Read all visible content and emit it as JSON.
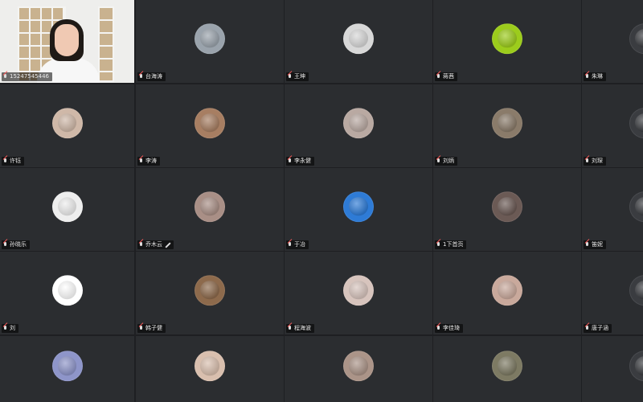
{
  "meeting": {
    "participants": [
      {
        "name": "15247545446",
        "type": "video"
      },
      {
        "name": "台海涛",
        "avatar_color": "#9aa3ac"
      },
      {
        "name": "王坤",
        "avatar_color": "#d8d8d8"
      },
      {
        "name": "蒋茜",
        "avatar_color": "#9ccc1c"
      },
      {
        "name": "朱琳",
        "avatar_color": "#3a3c40"
      },
      {
        "name": "许钰",
        "avatar_color": "#cfb8a8"
      },
      {
        "name": "李涛",
        "avatar_color": "#a77e62"
      },
      {
        "name": "李永健",
        "avatar_color": "#b9a9a2"
      },
      {
        "name": "刘炳",
        "avatar_color": "#8a7b6a"
      },
      {
        "name": "刘琛",
        "avatar_color": "#3a3c40"
      },
      {
        "name": "孙晓乐",
        "avatar_color": "#eeeeee"
      },
      {
        "name": "乔木云",
        "avatar_color": "#a98f86",
        "editing": true
      },
      {
        "name": "于冶",
        "avatar_color": "#2e7bd6"
      },
      {
        "name": "1下首页",
        "avatar_color": "#6b5a55"
      },
      {
        "name": "笛妮",
        "avatar_color": "#3a3c40"
      },
      {
        "name": "刘",
        "avatar_color": "#ffffff"
      },
      {
        "name": "韩子健",
        "avatar_color": "#8d6a4c"
      },
      {
        "name": "程海波",
        "avatar_color": "#d7c4bd"
      },
      {
        "name": "李佳琦",
        "avatar_color": "#c9a99c"
      },
      {
        "name": "唐子涵",
        "avatar_color": "#3a3c40"
      },
      {
        "name": "",
        "avatar_color": "#8e95c9"
      },
      {
        "name": "",
        "avatar_color": "#d9bfae"
      },
      {
        "name": "",
        "avatar_color": "#ab9488"
      },
      {
        "name": "",
        "avatar_color": "#7d7a63"
      },
      {
        "name": "",
        "avatar_color": "#3a3c40"
      }
    ]
  }
}
